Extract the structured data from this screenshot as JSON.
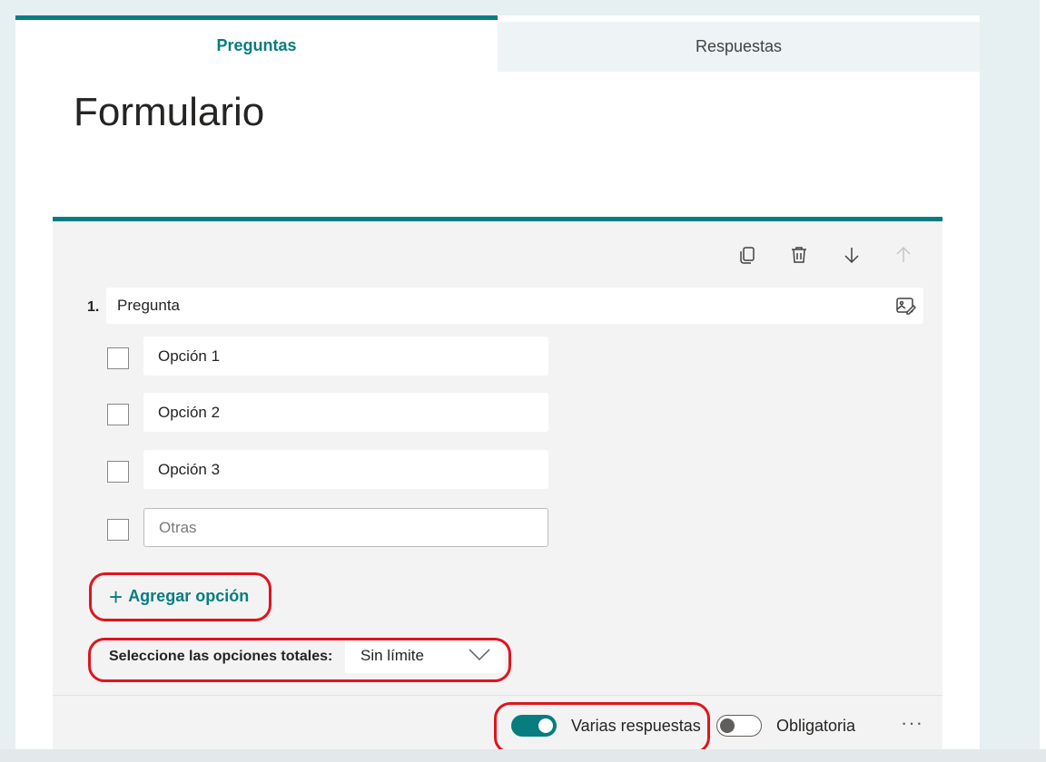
{
  "tabs": {
    "questions": "Preguntas",
    "responses": "Respuestas"
  },
  "form": {
    "title": "Formulario"
  },
  "question": {
    "number": "1.",
    "text": "Pregunta",
    "options": [
      "Opción 1",
      "Opción 2",
      "Opción 3"
    ],
    "other_placeholder": "Otras",
    "add_option_label": "Agregar opción",
    "select_total_label": "Seleccione las opciones totales:",
    "select_total_value": "Sin límite",
    "multiple_answers_label": "Varias respuestas",
    "multiple_answers_on": true,
    "required_label": "Obligatoria",
    "required_on": false,
    "more_label": "···"
  },
  "icons": {
    "copy": "copy-icon",
    "delete": "trash-icon",
    "move_down": "arrow-down-icon",
    "move_up": "arrow-up-icon",
    "image": "insert-image-icon",
    "dropdown": "chevron-down-icon"
  },
  "colors": {
    "accent": "#077d80",
    "highlight": "#e0141e",
    "background": "#e6eff1"
  }
}
